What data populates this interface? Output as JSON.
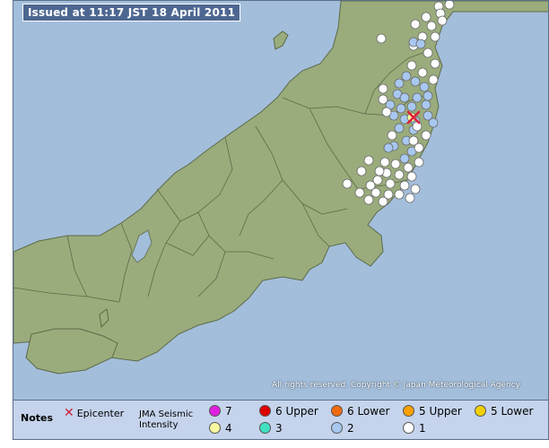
{
  "issued": "Issued at 11:17 JST  18 April 2011",
  "copyright": "All rights reserved. Copyright © Japan Meteorological Agency",
  "legend": {
    "notes": "Notes",
    "epicenter": "Epicenter",
    "scale_line1": "JMA Seismic",
    "scale_line2": "Intensity",
    "levels": [
      {
        "label": "7",
        "color": "#e020e0"
      },
      {
        "label": "6 Upper",
        "color": "#e00000"
      },
      {
        "label": "6 Lower",
        "color": "#f06a10"
      },
      {
        "label": "5 Upper",
        "color": "#f8a000"
      },
      {
        "label": "5 Lower",
        "color": "#f0d000"
      },
      {
        "label": "4",
        "color": "#f8f8a0"
      },
      {
        "label": "3",
        "color": "#40e0c0"
      },
      {
        "label": "2",
        "color": "#a8c8f0"
      },
      {
        "label": "1",
        "color": "#ffffff"
      }
    ]
  },
  "colors": {
    "sea": "#a3bedb",
    "land": "#9aac7c",
    "land_border": "#5d6a48",
    "epicenter": "#e0203c"
  }
}
